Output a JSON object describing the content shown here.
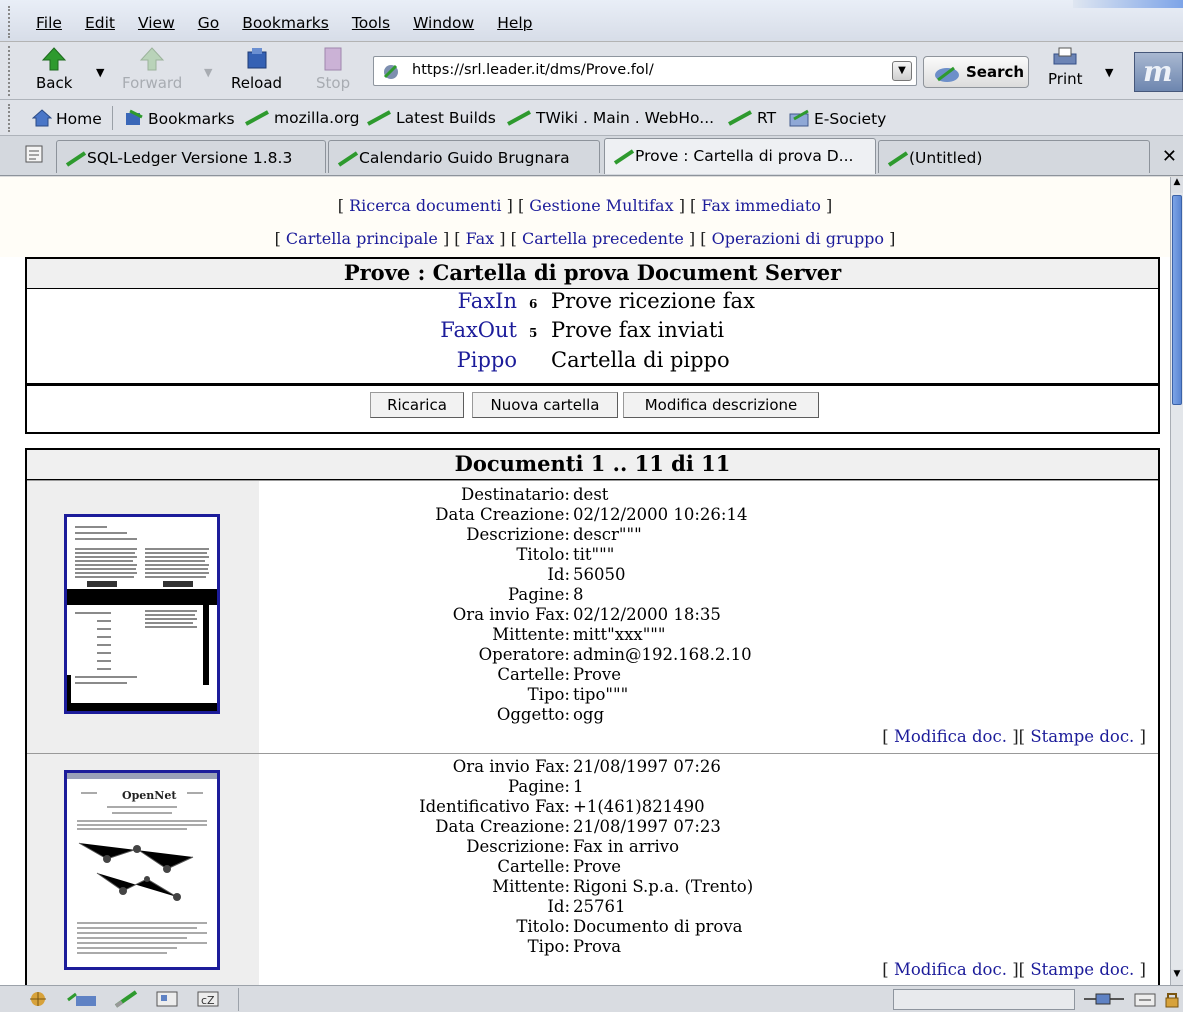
{
  "menu": [
    "File",
    "Edit",
    "View",
    "Go",
    "Bookmarks",
    "Tools",
    "Window",
    "Help"
  ],
  "nav": {
    "back_label": "Back",
    "forward_label": "Forward",
    "reload_label": "Reload",
    "stop_label": "Stop",
    "url": "https://srl.leader.it/dms/Prove.fol/",
    "search_label": "Search",
    "print_label": "Print"
  },
  "personal_toolbar": [
    "Home",
    "Bookmarks",
    "mozilla.org",
    "Latest Builds",
    "TWiki . Main . WebHo...",
    "RT",
    "E-Society"
  ],
  "tabs": [
    "SQL-Ledger Versione 1.8.3",
    "Calendario Guido Brugnara",
    "Prove : Cartella di prova D...",
    "(Untitled)"
  ],
  "page": {
    "links_row1": [
      "Ricerca documenti",
      "Gestione Multifax",
      "Fax immediato"
    ],
    "links_row2": [
      "Cartella principale",
      "Fax",
      "Cartella precedente",
      "Operazioni di gruppo"
    ],
    "folder_title": "Prove : Cartella di prova Document Server",
    "folders": [
      {
        "name": "FaxIn",
        "count": "6",
        "desc": "Prove ricezione fax"
      },
      {
        "name": "FaxOut",
        "count": "5",
        "desc": "Prove fax inviati"
      },
      {
        "name": "Pippo",
        "count": "",
        "desc": "Cartella di pippo"
      }
    ],
    "buttons": [
      "Ricarica",
      "Nuova cartella",
      "Modifica descrizione"
    ],
    "docs_title": "Documenti 1 .. 11 di 11",
    "doc_actions": [
      "Modifica doc.",
      "Stampe doc."
    ],
    "documents": [
      {
        "fields": [
          {
            "k": "Destinatario:",
            "v": "dest"
          },
          {
            "k": "Data Creazione:",
            "v": "02/12/2000 10:26:14"
          },
          {
            "k": "Descrizione:",
            "v": "descr\"\"\""
          },
          {
            "k": "Titolo:",
            "v": "tit\"\"\""
          },
          {
            "k": "Id:",
            "v": "56050"
          },
          {
            "k": "Pagine:",
            "v": "8"
          },
          {
            "k": "Ora invio Fax:",
            "v": "02/12/2000 18:35"
          },
          {
            "k": "Mittente:",
            "v": "mitt\"xxx\"\"\""
          },
          {
            "k": "Operatore:",
            "v": "admin@192.168.2.10"
          },
          {
            "k": "Cartelle:",
            "v": "Prove"
          },
          {
            "k": "Tipo:",
            "v": "tipo\"\"\""
          },
          {
            "k": "Oggetto:",
            "v": "ogg"
          }
        ]
      },
      {
        "fields": [
          {
            "k": "Ora invio Fax:",
            "v": "21/08/1997 07:26"
          },
          {
            "k": "Pagine:",
            "v": "1"
          },
          {
            "k": "Identificativo Fax:",
            "v": "+1(461)821490"
          },
          {
            "k": "Data Creazione:",
            "v": "21/08/1997 07:23"
          },
          {
            "k": "Descrizione:",
            "v": "Fax in arrivo"
          },
          {
            "k": "Cartelle:",
            "v": "Prove"
          },
          {
            "k": "Mittente:",
            "v": "Rigoni S.p.a. (Trento)"
          },
          {
            "k": "Id:",
            "v": "25761"
          },
          {
            "k": "Titolo:",
            "v": "Documento di prova"
          },
          {
            "k": "Tipo:",
            "v": "Prova"
          }
        ],
        "thumb_heading": "OpenNet"
      }
    ]
  }
}
